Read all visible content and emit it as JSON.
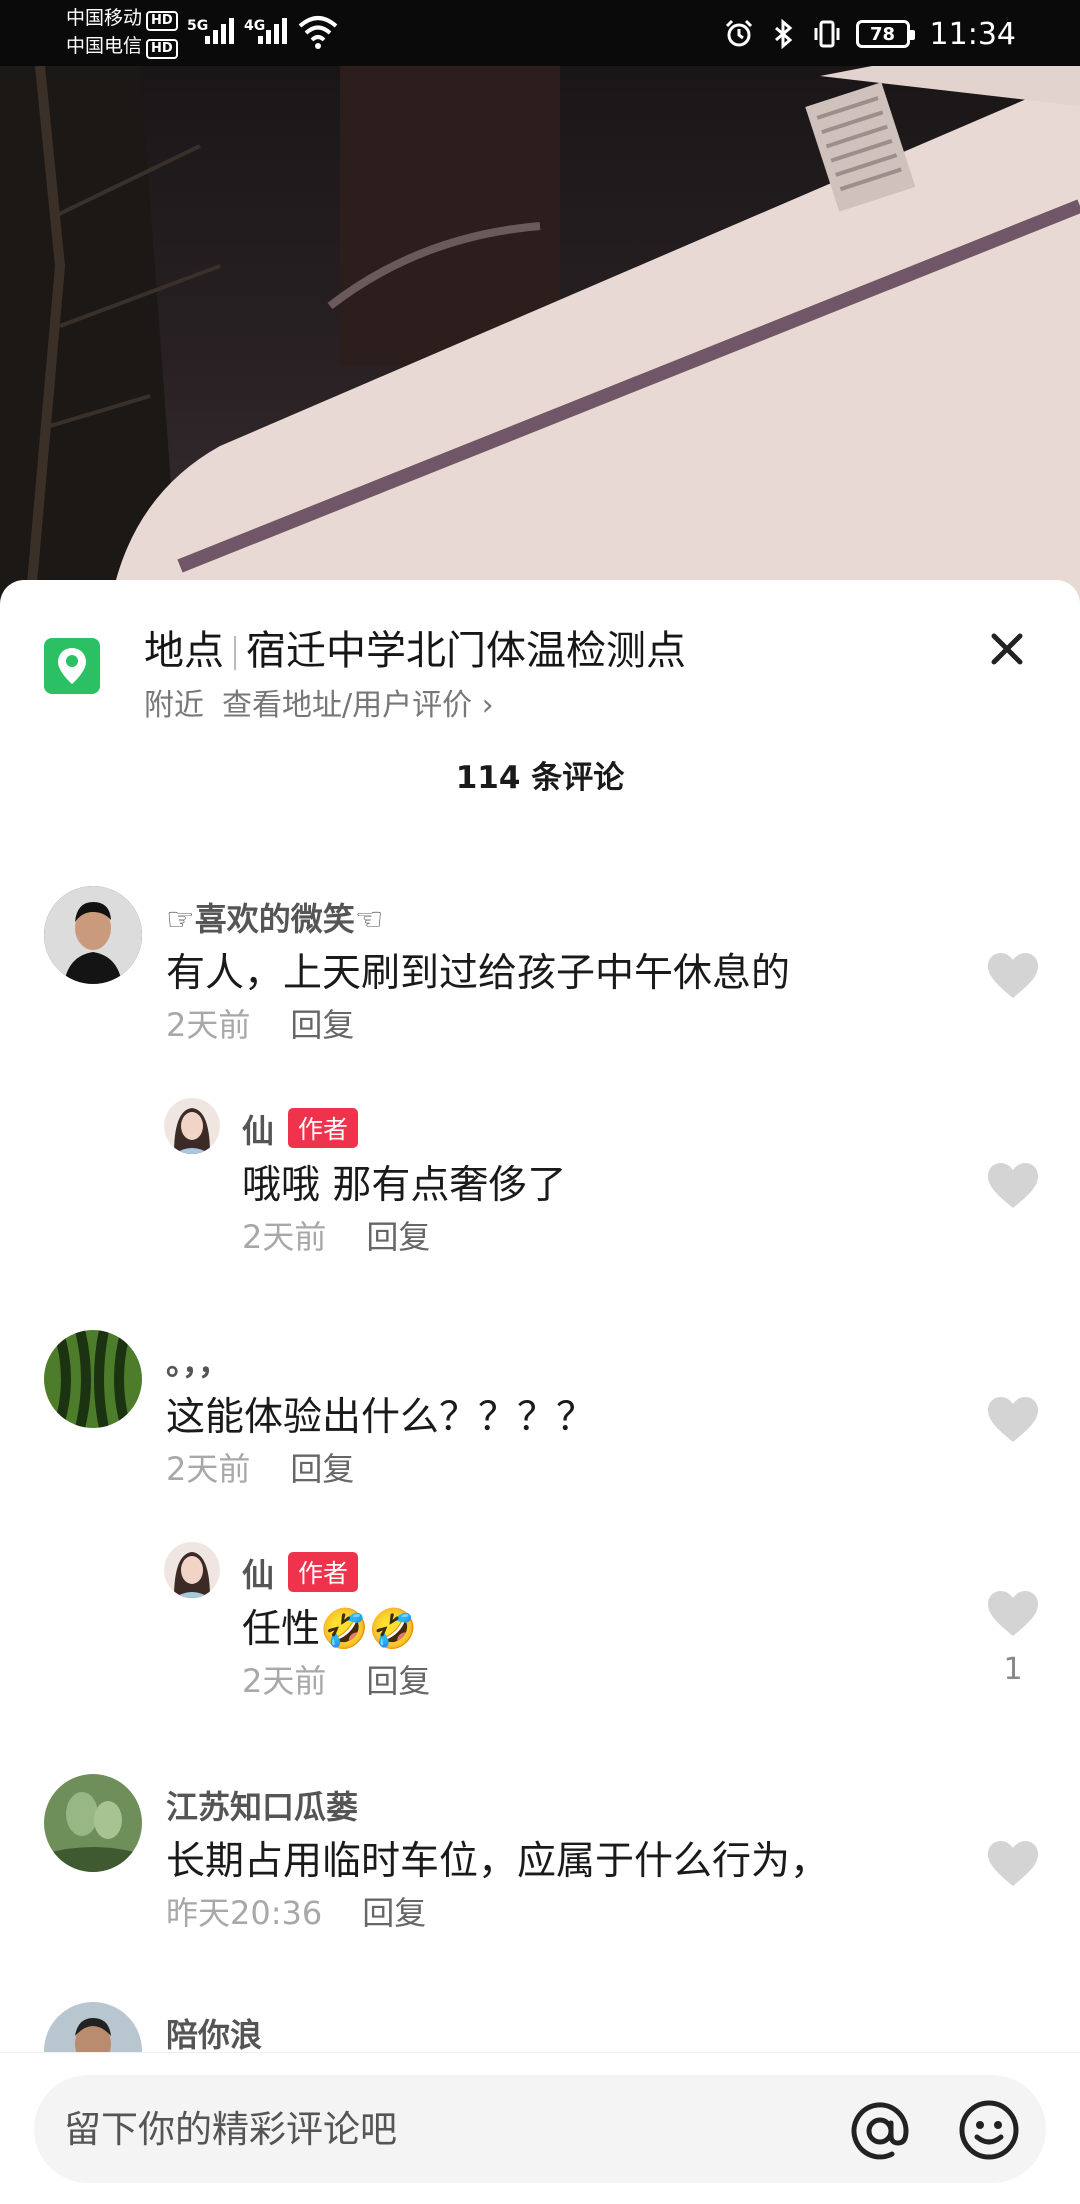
{
  "status_bar": {
    "carrier1": "中国移动",
    "carrier2": "中国电信",
    "hd": "HD",
    "net1": "5G",
    "net2": "4G",
    "battery": "78",
    "time": "11:34"
  },
  "location": {
    "label": "地点",
    "name": "宿迁中学北门体温检测点",
    "nearby": "附近",
    "view_link": "查看地址/用户评价 ›",
    "pin_color": "#2bc064"
  },
  "comment_count": "114 条评论",
  "author_badge": "作者",
  "comments": [
    {
      "user": "☞喜欢的微笑☜",
      "text": "有人，上天刷到过给孩子中午休息的",
      "time": "2天前",
      "reply_label": "回复",
      "avatar": "man-portrait-icon",
      "replies": [
        {
          "user": "仙",
          "text": "哦哦 那有点奢侈了",
          "time": "2天前",
          "reply_label": "回复",
          "avatar": "woman-portrait-icon"
        }
      ]
    },
    {
      "user": "。，，",
      "text": "这能体验出什么？？？？",
      "time": "2天前",
      "reply_label": "回复",
      "avatar": "watermelon-icon",
      "replies": [
        {
          "user": "仙",
          "text": "任性🤣🤣",
          "time": "2天前",
          "reply_label": "回复",
          "likes": "1",
          "avatar": "woman-portrait-icon"
        }
      ]
    },
    {
      "user": "江苏知口瓜蒌",
      "text": "长期占用临时车位，应属于什么行为，",
      "time": "昨天20:36",
      "reply_label": "回复",
      "avatar": "melon-plant-icon"
    },
    {
      "user": "陪你浪",
      "avatar": "man-portrait-icon"
    }
  ],
  "input": {
    "placeholder": "留下你的精彩评论吧"
  },
  "colors": {
    "badge": "#f0334d",
    "heart": "#d4d4d4"
  }
}
